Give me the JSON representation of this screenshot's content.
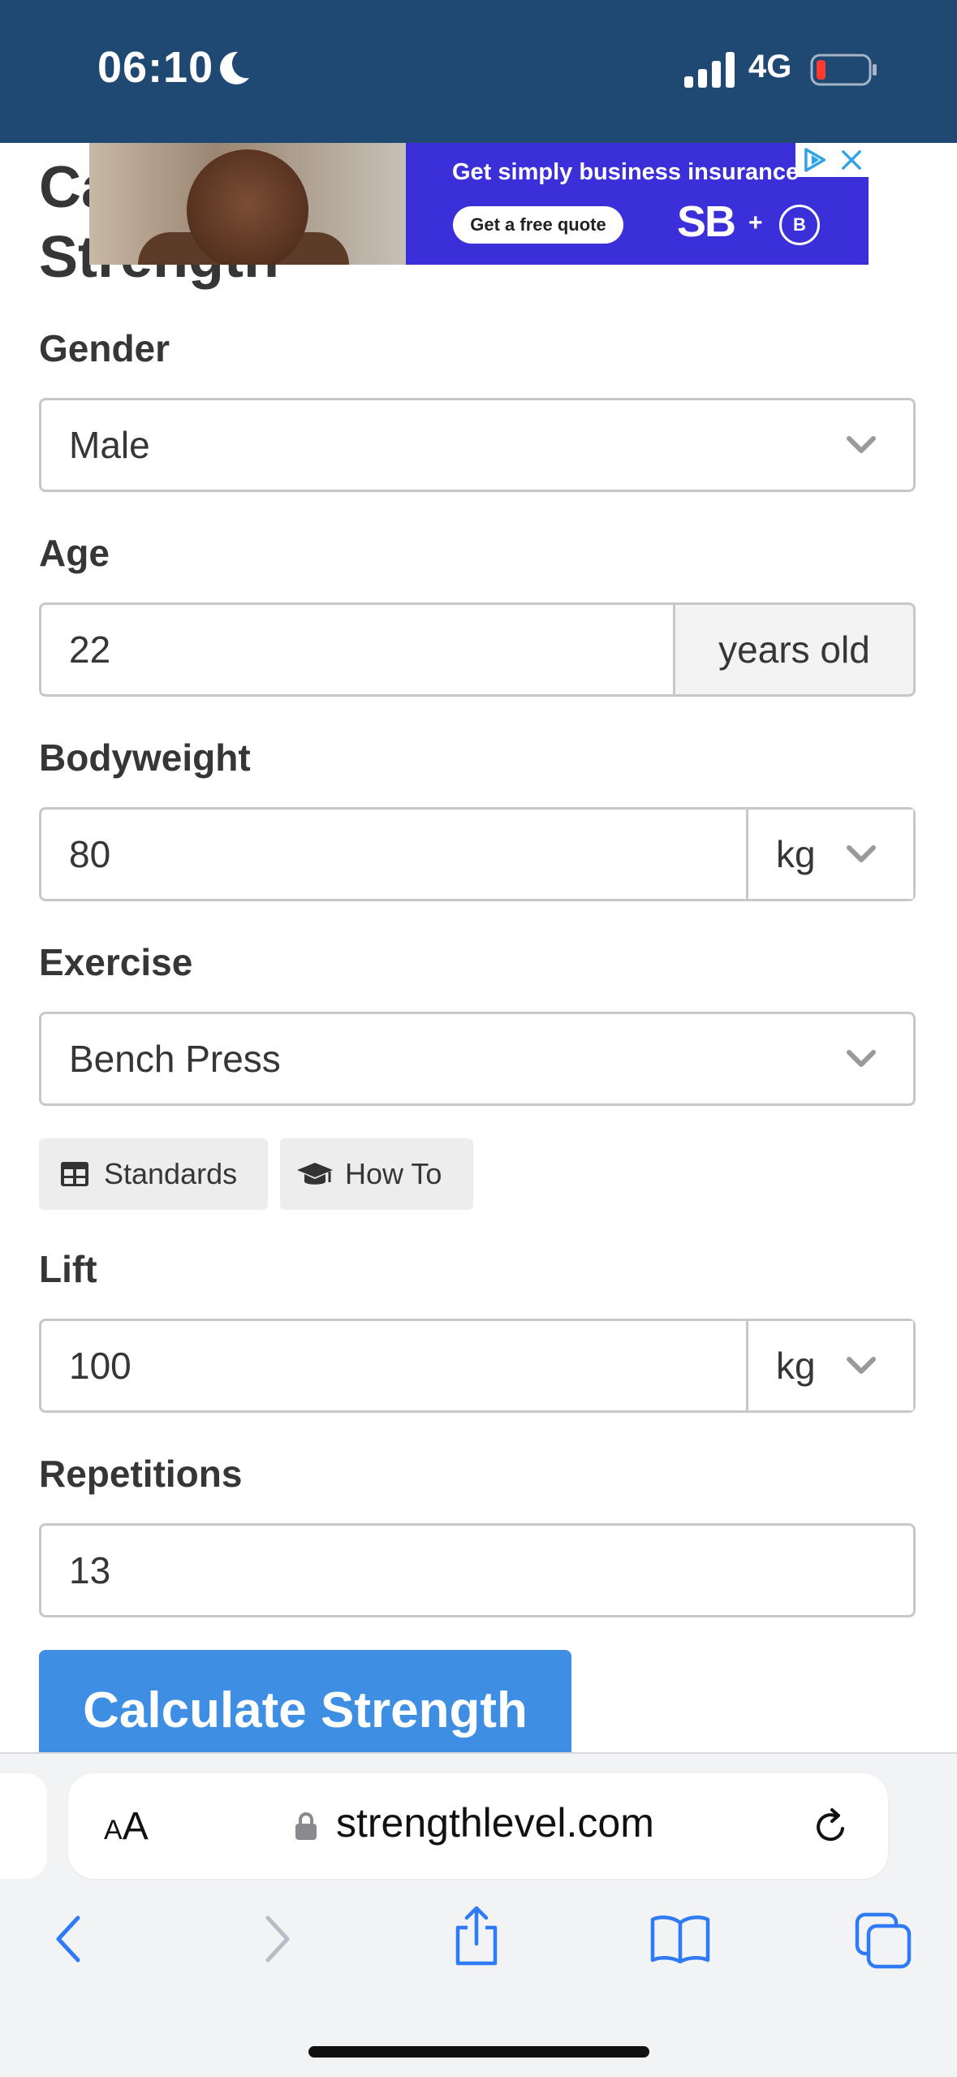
{
  "status_bar": {
    "time": "06:10",
    "network": "4G"
  },
  "ad": {
    "headline": "Get simply business insurance",
    "cta": "Get a free quote",
    "logo": "SB",
    "plus": "+",
    "badge": "B"
  },
  "page": {
    "title": "Calculate Strength"
  },
  "form": {
    "gender": {
      "label": "Gender",
      "value": "Male"
    },
    "age": {
      "label": "Age",
      "value": "22",
      "suffix": "years old"
    },
    "bodyweight": {
      "label": "Bodyweight",
      "value": "80",
      "unit": "kg"
    },
    "exercise": {
      "label": "Exercise",
      "value": "Bench Press"
    },
    "tools": {
      "standards": "Standards",
      "how_to": "How To"
    },
    "lift": {
      "label": "Lift",
      "value": "100",
      "unit": "kg"
    },
    "repetitions": {
      "label": "Repetitions",
      "value": "13"
    },
    "submit": "Calculate Strength"
  },
  "browser": {
    "text_size_small": "A",
    "text_size_large": "A",
    "url": "strengthlevel.com"
  },
  "colors": {
    "status_bar": "#1f4872",
    "primary_button": "#3e8ee4",
    "ad_background": "#3a2fd8",
    "browser_accent": "#2f7bf6"
  }
}
